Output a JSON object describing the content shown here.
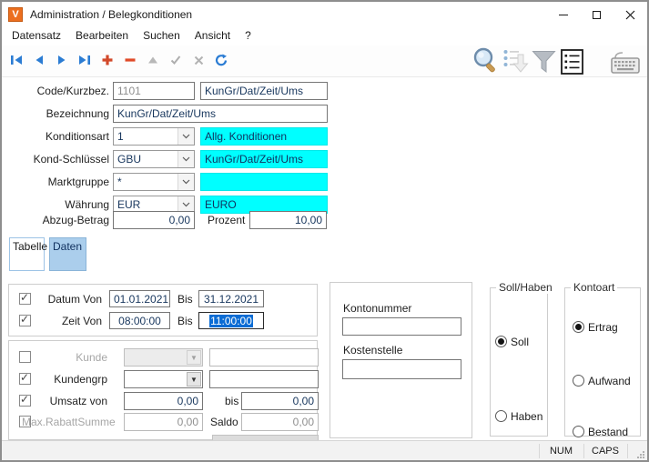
{
  "window": {
    "title": "Administration / Belegkonditionen",
    "icon_letter": "V"
  },
  "menu": {
    "items": [
      "Datensatz",
      "Bearbeiten",
      "Suchen",
      "Ansicht",
      "?"
    ]
  },
  "toolbar": {
    "left_icons": [
      "first-record",
      "previous-record",
      "next-record",
      "last-record",
      "add-record",
      "delete-record",
      "move-up",
      "apply",
      "cancel",
      "refresh"
    ],
    "right_icons": [
      "search",
      "sort-list",
      "filter",
      "list-view",
      "keyboard"
    ]
  },
  "form": {
    "code": {
      "label": "Code/Kurzbez.",
      "value": "1101",
      "name": "KunGr/Dat/Zeit/Ums"
    },
    "bezeichnung": {
      "label": "Bezeichnung",
      "value": "KunGr/Dat/Zeit/Ums"
    },
    "konditionsart": {
      "label": "Konditionsart",
      "value": "1",
      "text": "Allg. Konditionen"
    },
    "kond_schluessel": {
      "label": "Kond-Schlüssel",
      "value": "GBU",
      "text": "KunGr/Dat/Zeit/Ums"
    },
    "marktgruppe": {
      "label": "Marktgruppe",
      "value": "*",
      "text": ""
    },
    "waehrung": {
      "label": "Währung",
      "value": "EUR",
      "text": "EURO"
    },
    "abzug": {
      "label": "Abzug-Betrag",
      "value": "0,00"
    },
    "prozent": {
      "label": "Prozent",
      "value": "10,00"
    }
  },
  "tabs": [
    {
      "label": "Tabelle",
      "active": false
    },
    {
      "label": "Daten",
      "active": true
    }
  ],
  "daten": {
    "datum": {
      "checked": true,
      "label": "Datum Von",
      "von": "01.01.2021",
      "bis_label": "Bis",
      "bis": "31.12.2021"
    },
    "zeit": {
      "checked": true,
      "label": "Zeit Von",
      "von": "08:00:00",
      "bis_label": "Bis",
      "bis": "11:00:00",
      "bis_selected": true
    },
    "kunde": {
      "checked": false,
      "label": "Kunde",
      "value": "",
      "name": ""
    },
    "kundengrp": {
      "checked": true,
      "label": "Kundengrp",
      "value": "",
      "name": ""
    },
    "umsatz": {
      "checked": true,
      "label": "Umsatz von",
      "von": "0,00",
      "bis_label": "bis",
      "bis": "0,00"
    },
    "rabatt": {
      "checked": false,
      "label": "Max.RabattSumme",
      "value": "0,00",
      "saldo_label": "Saldo",
      "saldo": "0,00"
    },
    "kontonummer_label": "Kontonummer",
    "kostenstelle_label": "Kostenstelle",
    "soll_haben": {
      "title": "Soll/Haben",
      "options": [
        {
          "label": "Soll",
          "selected": true
        },
        {
          "label": "Haben",
          "selected": false
        }
      ]
    },
    "kontoart": {
      "title": "Kontoart",
      "options": [
        {
          "label": "Ertrag",
          "selected": true
        },
        {
          "label": "Aufwand",
          "selected": false
        },
        {
          "label": "Bestand",
          "selected": false
        }
      ]
    }
  },
  "statusbar": {
    "num": "NUM",
    "caps": "CAPS"
  },
  "colors": {
    "highlight_cyan": "#00ffff",
    "selection_blue": "#0b6cd4",
    "tab_active_blue": "#abceec",
    "icon_blue": "#2b7cd3",
    "icon_red": "#d2492a",
    "app_icon_orange": "#ec6f1f"
  }
}
